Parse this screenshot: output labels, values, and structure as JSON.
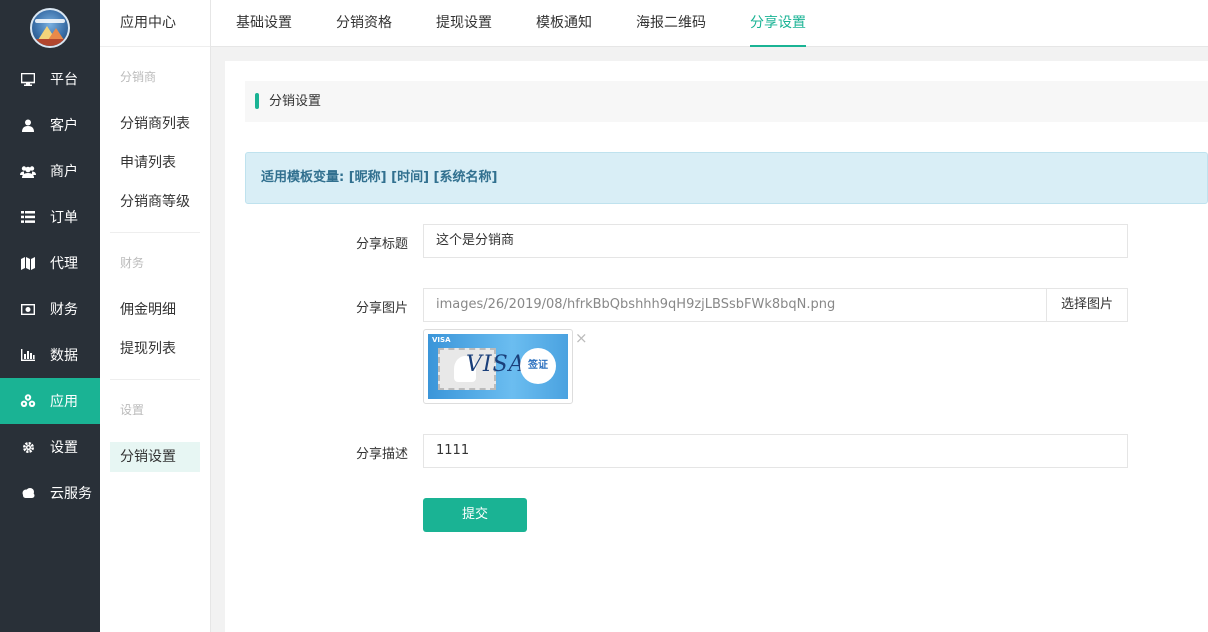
{
  "sidebar": {
    "items": [
      {
        "label": "平台",
        "icon": "monitor-icon"
      },
      {
        "label": "客户",
        "icon": "user-icon"
      },
      {
        "label": "商户",
        "icon": "users-icon"
      },
      {
        "label": "订单",
        "icon": "list-icon"
      },
      {
        "label": "代理",
        "icon": "map-icon"
      },
      {
        "label": "财务",
        "icon": "money-icon"
      },
      {
        "label": "数据",
        "icon": "bar-chart-icon"
      },
      {
        "label": "应用",
        "icon": "cubes-icon",
        "active": true
      },
      {
        "label": "设置",
        "icon": "gear-icon"
      },
      {
        "label": "云服务",
        "icon": "cloud-icon"
      }
    ]
  },
  "subnav": {
    "title": "应用中心",
    "group1": "分销商",
    "item1": "分销商列表",
    "item2": "申请列表",
    "item3": "分销商等级",
    "group2": "财务",
    "item4": "佣金明细",
    "item5": "提现列表",
    "group3": "设置",
    "item6": "分销设置"
  },
  "tabs": [
    "基础设置",
    "分销资格",
    "提现设置",
    "模板通知",
    "海报二维码",
    "分享设置"
  ],
  "active_tab": "分享设置",
  "section_title": "分销设置",
  "alert_text": "适用模板变量: [昵称] [时间] [系统名称]",
  "form": {
    "title_label": "分享标题",
    "title_value": "这个是分销商",
    "image_label": "分享图片",
    "image_value": "images/26/2019/08/hfrkBbQbshhh9qH9zjLBSsbFWk8bqN.png",
    "image_button": "选择图片",
    "thumb_tag": "VISA",
    "thumb_word": "VISA",
    "thumb_seal": "签证",
    "close_glyph": "×",
    "desc_label": "分享描述",
    "desc_value": "1111",
    "submit": "提交"
  },
  "colors": {
    "accent": "#1ab394",
    "sidebar_bg": "#293038",
    "alert_bg": "#d9eef6"
  }
}
